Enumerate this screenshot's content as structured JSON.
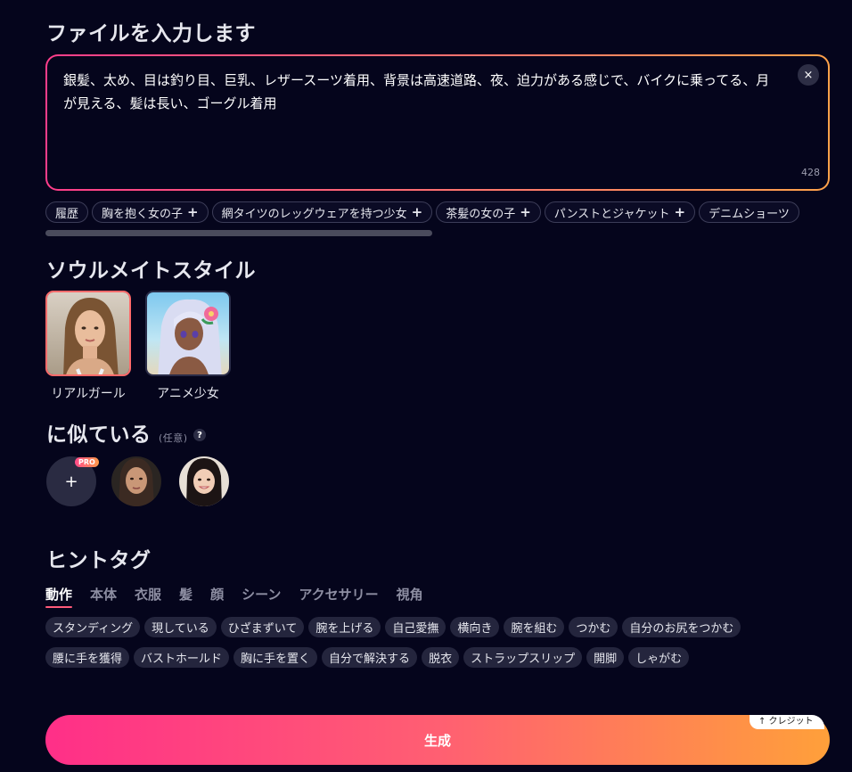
{
  "prompt": {
    "heading": "ファイルを入力します",
    "text": "銀髪、太め、目は釣り目、巨乳、レザースーツ着用、背景は高速道路、夜、迫力がある感じで、バイクに乗ってる、月が見える、髪は長い、ゴーグル着用",
    "clear_label": "×",
    "char_count": "428"
  },
  "suggestions": {
    "items": [
      {
        "label": "履歴",
        "plus": ""
      },
      {
        "label": "胸を抱く女の子",
        "plus": "+"
      },
      {
        "label": "網タイツのレッグウェアを持つ少女",
        "plus": "+"
      },
      {
        "label": "茶髪の女の子",
        "plus": "+"
      },
      {
        "label": "パンストとジャケット",
        "plus": "+"
      },
      {
        "label": "デニムショーツ",
        "plus": ""
      }
    ]
  },
  "style": {
    "heading": "ソウルメイトスタイル",
    "options": [
      {
        "label": "リアルガール",
        "selected": true
      },
      {
        "label": "アニメ少女",
        "selected": false
      }
    ]
  },
  "similar": {
    "heading": "に似ている",
    "optional": "(任意)",
    "help": "?",
    "add_label": "+",
    "pro_badge": "PRO"
  },
  "hints": {
    "heading": "ヒントタグ",
    "tabs": [
      "動作",
      "本体",
      "衣服",
      "髪",
      "顔",
      "シーン",
      "アクセサリー",
      "視角"
    ],
    "active_tab": "動作",
    "row1": [
      "スタンディング",
      "現している",
      "ひざまずいて",
      "腕を上げる",
      "自己愛撫",
      "横向き",
      "腕を組む",
      "つかむ",
      "自分のお尻をつかむ"
    ],
    "row2": [
      "腰に手を獲得",
      "バストホールド",
      "胸に手を置く",
      "自分で解決する",
      "脱衣",
      "ストラップスリップ",
      "開脚",
      "しゃがむ"
    ]
  },
  "generate": {
    "label": "生成",
    "credit": "↑ クレジット"
  },
  "colors": {
    "background": "#05051c",
    "accent_start": "#ff2f88",
    "accent_end": "#ffa03a"
  }
}
